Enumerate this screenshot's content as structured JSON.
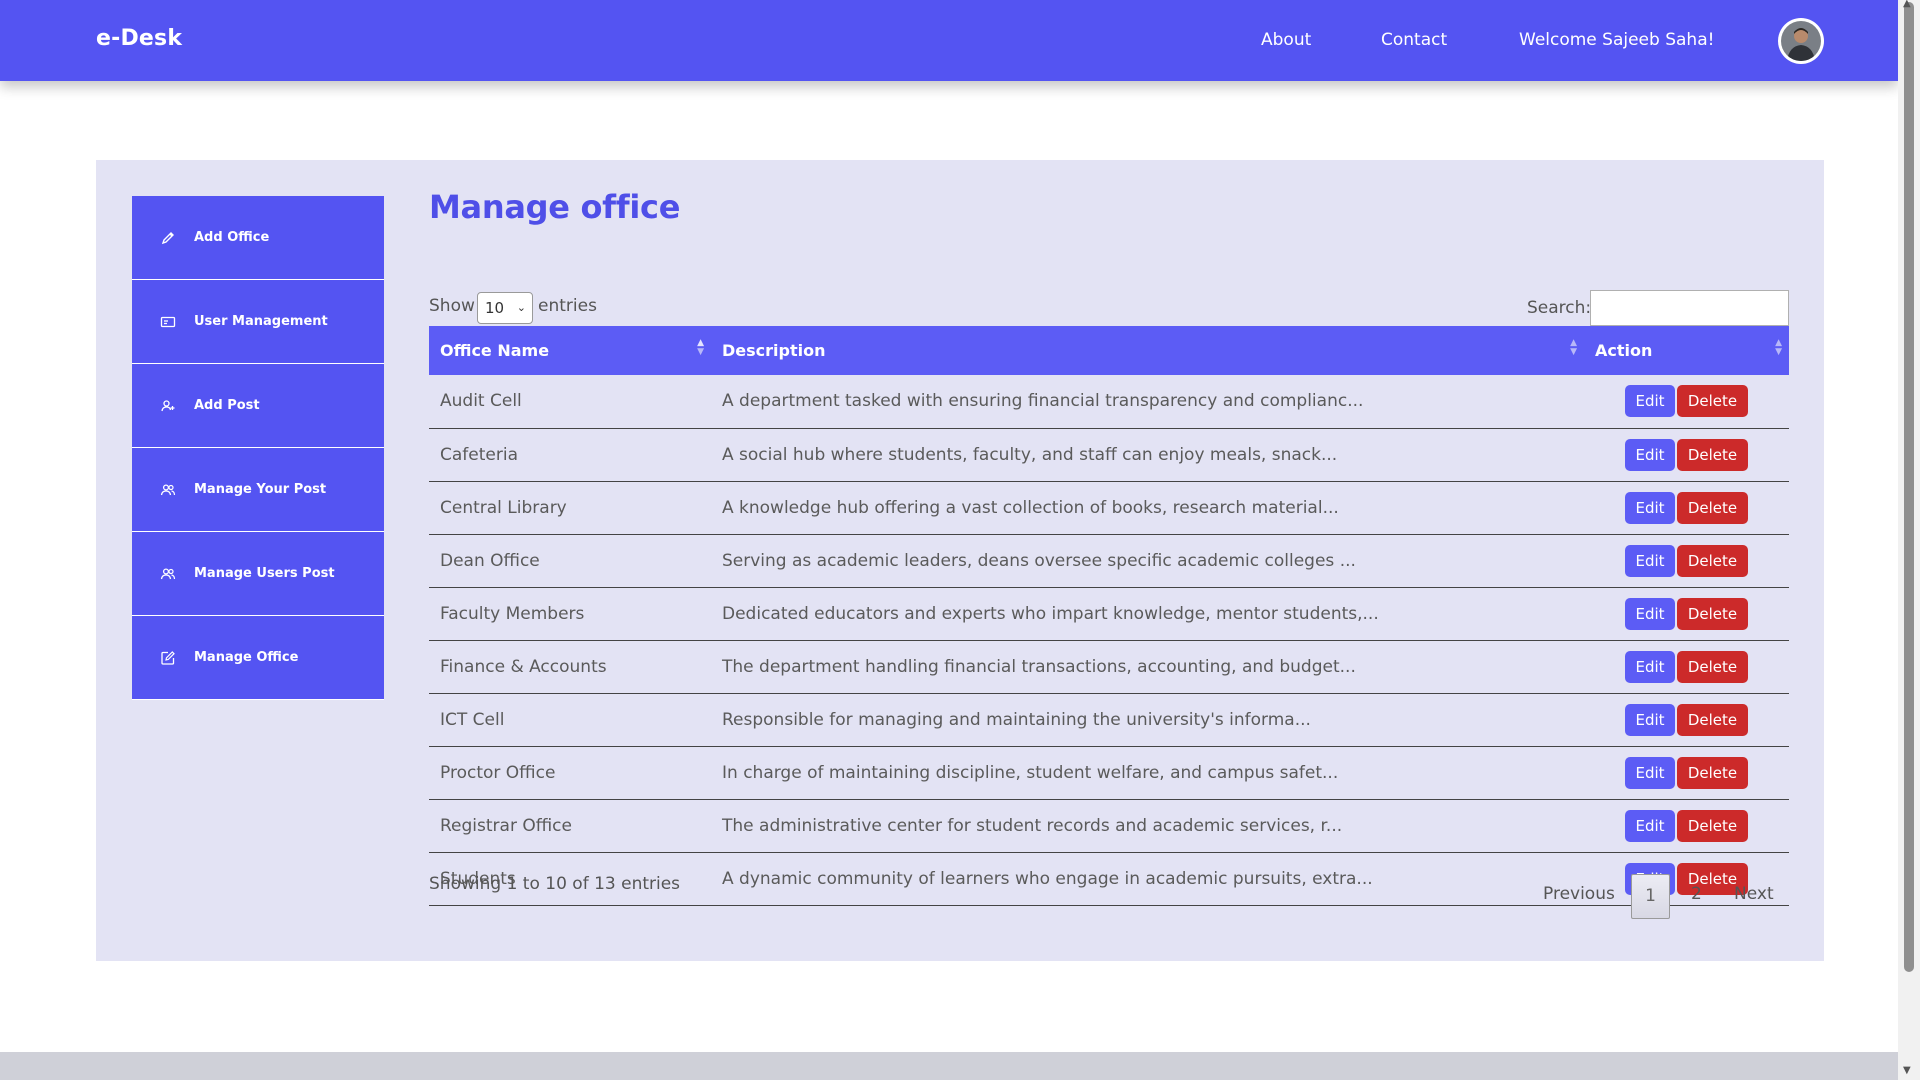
{
  "header": {
    "brand": "e-Desk",
    "nav": {
      "about": "About",
      "contact": "Contact",
      "welcome": "Welcome Sajeeb Saha!"
    },
    "avatar_icon": "user-avatar"
  },
  "sidebar": {
    "items": [
      {
        "label": "Add Office",
        "icon": "pencil-icon"
      },
      {
        "label": "User Management",
        "icon": "id-card-icon"
      },
      {
        "label": "Add Post",
        "icon": "user-plus-icon"
      },
      {
        "label": "Manage Your Post",
        "icon": "users-icon"
      },
      {
        "label": "Manage Users Post",
        "icon": "users-icon"
      },
      {
        "label": "Manage Office",
        "icon": "edit-square-icon"
      }
    ]
  },
  "main": {
    "title": "Manage office",
    "show_label": "Show",
    "page_length": "10",
    "entries_label": "entries",
    "search_label": "Search:",
    "search_value": "",
    "columns": [
      "Office Name",
      "Description",
      "Action"
    ],
    "rows": [
      {
        "name": "Audit Cell",
        "description": "A department tasked with ensuring financial transparency and complianc..."
      },
      {
        "name": "Cafeteria",
        "description": "A social hub where students, faculty, and staff can enjoy meals, snack..."
      },
      {
        "name": "Central Library",
        "description": "A knowledge hub offering a vast collection of books, research material..."
      },
      {
        "name": "Dean Office",
        "description": "Serving as academic leaders, deans oversee specific academic colleges ..."
      },
      {
        "name": "Faculty Members",
        "description": "Dedicated educators and experts who impart knowledge, mentor students,..."
      },
      {
        "name": "Finance & Accounts",
        "description": "The department handling financial transactions, accounting, and budget..."
      },
      {
        "name": "ICT Cell",
        "description": "Responsible for managing and maintaining the university's informa..."
      },
      {
        "name": "Proctor Office",
        "description": "In charge of maintaining discipline, student welfare, and campus safet..."
      },
      {
        "name": "Registrar Office",
        "description": "The administrative center for student records and academic services, r..."
      },
      {
        "name": "Students",
        "description": "A dynamic community of learners who engage in academic pursuits, extra..."
      }
    ],
    "edit_label": "Edit",
    "delete_label": "Delete",
    "info": "Showing 1 to 10 of 13 entries",
    "pagination": {
      "previous": "Previous",
      "pages": [
        "1",
        "2"
      ],
      "current": "1",
      "next": "Next"
    }
  },
  "colors": {
    "primary": "#5454f2",
    "panel_bg": "#e3e3f4",
    "delete": "#cc2a2a",
    "title": "#4f4fe8"
  }
}
